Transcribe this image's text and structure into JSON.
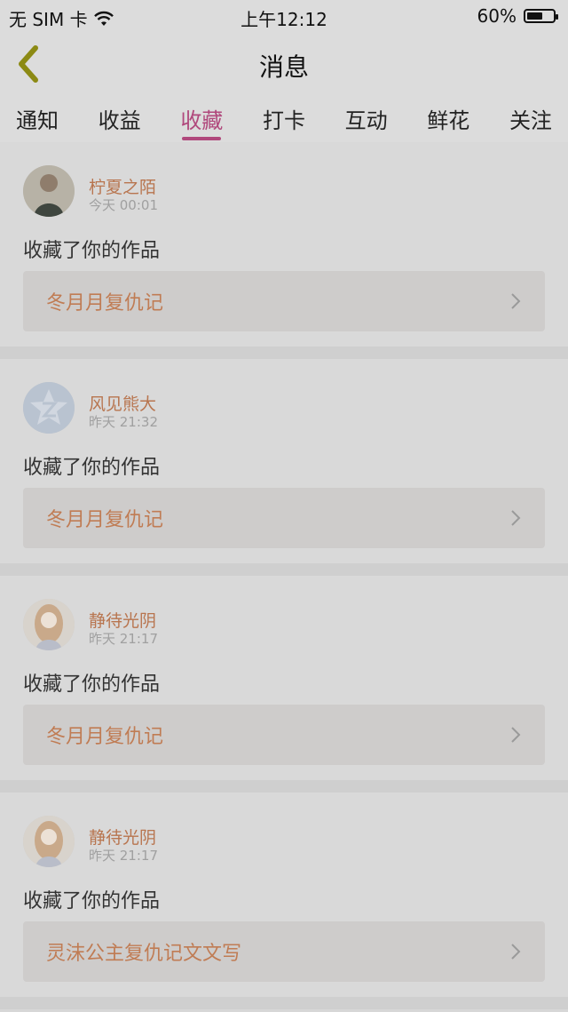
{
  "status_bar": {
    "carrier": "无 SIM 卡",
    "time": "上午12:12",
    "battery": "60%",
    "battery_level": 0.6
  },
  "header": {
    "title": "消息",
    "back_icon": "chevron-left-icon"
  },
  "tabs": [
    {
      "label": "通知",
      "active": false
    },
    {
      "label": "收益",
      "active": false
    },
    {
      "label": "收藏",
      "active": true
    },
    {
      "label": "打卡",
      "active": false
    },
    {
      "label": "互动",
      "active": false
    },
    {
      "label": "鲜花",
      "active": false
    },
    {
      "label": "关注",
      "active": false
    }
  ],
  "colors": {
    "accent": "#b0487c",
    "username": "#b8754f",
    "work_title": "#c07c54"
  },
  "messages": [
    {
      "user": "柠夏之陌",
      "time": "今天 00:01",
      "action": "收藏了你的作品",
      "work": "冬月月复仇记",
      "avatar": "girl-photo"
    },
    {
      "user": "风见熊大",
      "time": "昨天 21:32",
      "action": "收藏了你的作品",
      "work": "冬月月复仇记",
      "avatar": "qq-default-avatar"
    },
    {
      "user": "静待光阴",
      "time": "昨天 21:17",
      "action": "收藏了你的作品",
      "work": "冬月月复仇记",
      "avatar": "anime-girl"
    },
    {
      "user": "静待光阴",
      "time": "昨天 21:17",
      "action": "收藏了你的作品",
      "work": "灵沫公主复仇记文文写",
      "avatar": "anime-girl"
    }
  ]
}
